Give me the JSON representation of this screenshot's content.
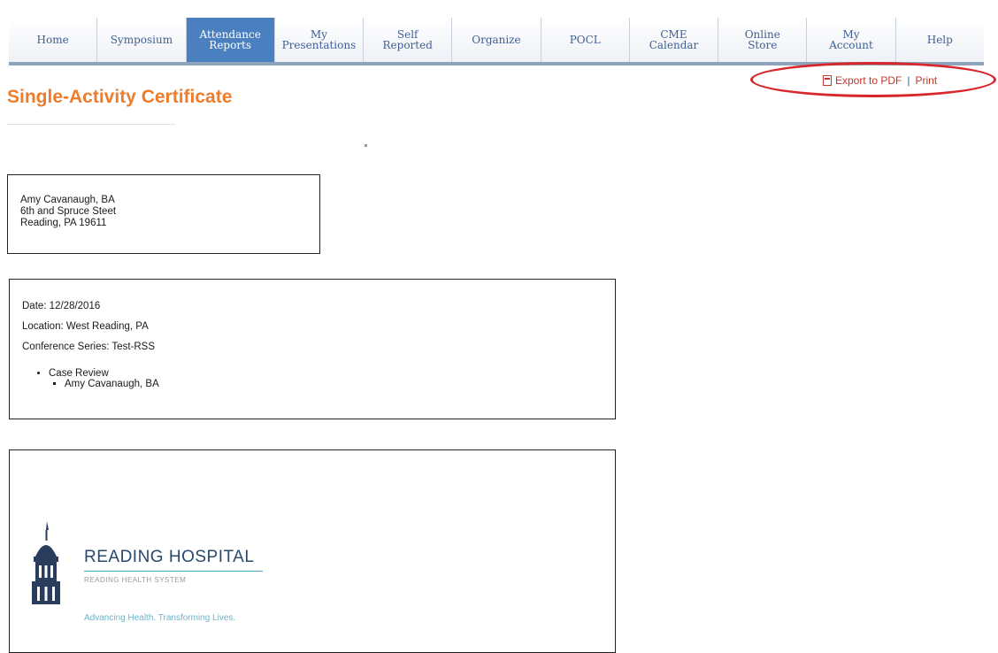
{
  "nav": {
    "items": [
      {
        "label": "Home"
      },
      {
        "label": "Symposium"
      },
      {
        "label": "Attendance\nReports"
      },
      {
        "label": "My\nPresentations"
      },
      {
        "label": "Self\nReported"
      },
      {
        "label": "Organize"
      },
      {
        "label": "POCL"
      },
      {
        "label": "CME\nCalendar"
      },
      {
        "label": "Online\nStore"
      },
      {
        "label": "My\nAccount"
      },
      {
        "label": "Help"
      }
    ],
    "active_index": 2
  },
  "export": {
    "pdf_label": "Export to PDF",
    "separator": "|",
    "print_label": "Print"
  },
  "page": {
    "title": "Single-Activity Certificate"
  },
  "address": {
    "name": "Amy Cavanaugh, BA",
    "street": "6th and Spruce Steet",
    "city_state_zip": "Reading, PA 19611"
  },
  "details": {
    "date": "Date: 12/28/2016",
    "location": "Location: West Reading, PA",
    "series": "Conference Series: Test-RSS",
    "activity": "Case Review",
    "presenter": "Amy Cavanaugh, BA"
  },
  "logo": {
    "name": "READING HOSPITAL",
    "subtitle": "READING HEALTH SYSTEM",
    "tagline": "Advancing Health. Transforming Lives."
  },
  "colors": {
    "title_orange": "#ee7d2b",
    "nav_active": "#4a7fc0",
    "nav_text": "#3f5f95",
    "link_red": "#c0392b",
    "highlight_circle": "#d8262a"
  }
}
